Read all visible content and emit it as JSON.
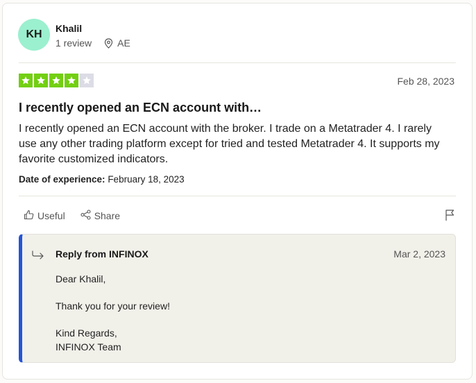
{
  "reviewer": {
    "initials": "KH",
    "name": "Khalil",
    "review_count": "1 review",
    "country": "AE",
    "avatar_color": "#9bf0cf"
  },
  "review": {
    "rating": 4,
    "max_rating": 5,
    "star_color": "#73cf11",
    "empty_star_color": "#dcdce6",
    "date": "Feb 28, 2023",
    "title": "I recently opened an ECN account with…",
    "body": "I recently opened an ECN account with the broker. I trade on a Metatrader 4. I rarely use any other trading platform except for tried and tested Metatrader 4. It supports my favorite customized indicators.",
    "experience_label": "Date of experience:",
    "experience_date": "February 18, 2023"
  },
  "actions": {
    "useful_label": "Useful",
    "share_label": "Share"
  },
  "reply": {
    "title": "Reply from INFINOX",
    "date": "Mar 2, 2023",
    "accent_color": "#2454d6",
    "greeting": "Dear Khalil,",
    "thanks": "Thank you for your review!",
    "signoff": "Kind Regards,",
    "team": "INFINOX Team"
  }
}
